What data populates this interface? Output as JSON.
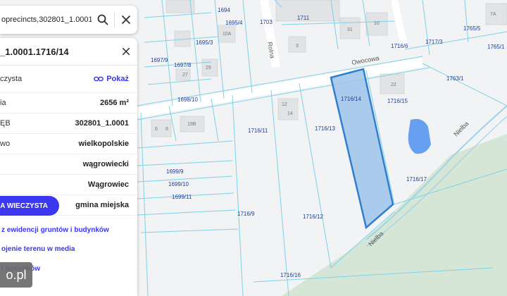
{
  "search": {
    "query": "oprecincts,302801_1.0001"
  },
  "panel": {
    "title": "_1.0001.1716/14",
    "land_register_label": "czysta",
    "land_register_link": "Pokaż",
    "rows": [
      {
        "label": "ia",
        "value": "2656 m²"
      },
      {
        "label": "ĘB",
        "value": "302801_1.0001"
      },
      {
        "label": "wo",
        "value": "wielkopolskie"
      },
      {
        "label": "",
        "value": "wągrowiecki"
      },
      {
        "label": "",
        "value": "Wągrowiec"
      },
      {
        "label": "",
        "value": "gmina miejska"
      }
    ],
    "primary_button": "GA WIECZYSTA",
    "links": [
      "z ewidencji gruntów i budynków",
      "ojenie terenu w media",
      "i budynków"
    ]
  },
  "watermark": "o.pl",
  "map": {
    "parcel_labels": [
      {
        "id": "1694",
        "text": "1694"
      },
      {
        "id": "1695-4",
        "text": "1695/4"
      },
      {
        "id": "1703",
        "text": "1703"
      },
      {
        "id": "1711",
        "text": "1711"
      },
      {
        "id": "1695-3",
        "text": "1695/3"
      },
      {
        "id": "1697-9",
        "text": "1697/9"
      },
      {
        "id": "1697-8",
        "text": "1697/8"
      },
      {
        "id": "1698-10",
        "text": "1698/10"
      },
      {
        "id": "1716-14",
        "text": "1716/14"
      },
      {
        "id": "1716-15",
        "text": "1716/15"
      },
      {
        "id": "1716-6",
        "text": "1716/6"
      },
      {
        "id": "1717-3",
        "text": "1717/3"
      },
      {
        "id": "1765-5",
        "text": "1765/5"
      },
      {
        "id": "1765-1",
        "text": "1765/1"
      },
      {
        "id": "1763-1",
        "text": "1763/1"
      },
      {
        "id": "1716-11",
        "text": "1716/11"
      },
      {
        "id": "1716-13",
        "text": "1716/13"
      },
      {
        "id": "1716-17",
        "text": "1716/17"
      },
      {
        "id": "1699-9",
        "text": "1699/9"
      },
      {
        "id": "1699-10",
        "text": "1699/10"
      },
      {
        "id": "1699-11",
        "text": "1699/11"
      },
      {
        "id": "1716-9",
        "text": "1716/9"
      },
      {
        "id": "1716-12",
        "text": "1716/12"
      },
      {
        "id": "1716-16",
        "text": "1716/16"
      }
    ],
    "street_labels": [
      {
        "id": "owocowa",
        "text": "Owocowa"
      },
      {
        "id": "rolna",
        "text": "Rolna"
      },
      {
        "id": "nielba-1",
        "text": "Nielba"
      },
      {
        "id": "nielba-2",
        "text": "Nielba"
      }
    ],
    "building_numbers": [
      {
        "id": "b31",
        "text": "31"
      },
      {
        "id": "b10",
        "text": "10"
      },
      {
        "id": "b10a",
        "text": "10A"
      },
      {
        "id": "b29",
        "text": "29"
      },
      {
        "id": "b27",
        "text": "27"
      },
      {
        "id": "b3",
        "text": "3"
      },
      {
        "id": "b22",
        "text": "22"
      },
      {
        "id": "b12",
        "text": "12"
      },
      {
        "id": "b14",
        "text": "14"
      },
      {
        "id": "b19b",
        "text": "19B"
      },
      {
        "id": "b6",
        "text": "6"
      },
      {
        "id": "b8",
        "text": "8"
      },
      {
        "id": "b7a",
        "text": "7A"
      }
    ],
    "colors": {
      "selected_fill": "#9ec3ea",
      "selected_stroke": "#2f7fd1",
      "boundary": "#7fd1e8",
      "water": "#4f8ff0",
      "green": "#d5e5d6"
    }
  }
}
